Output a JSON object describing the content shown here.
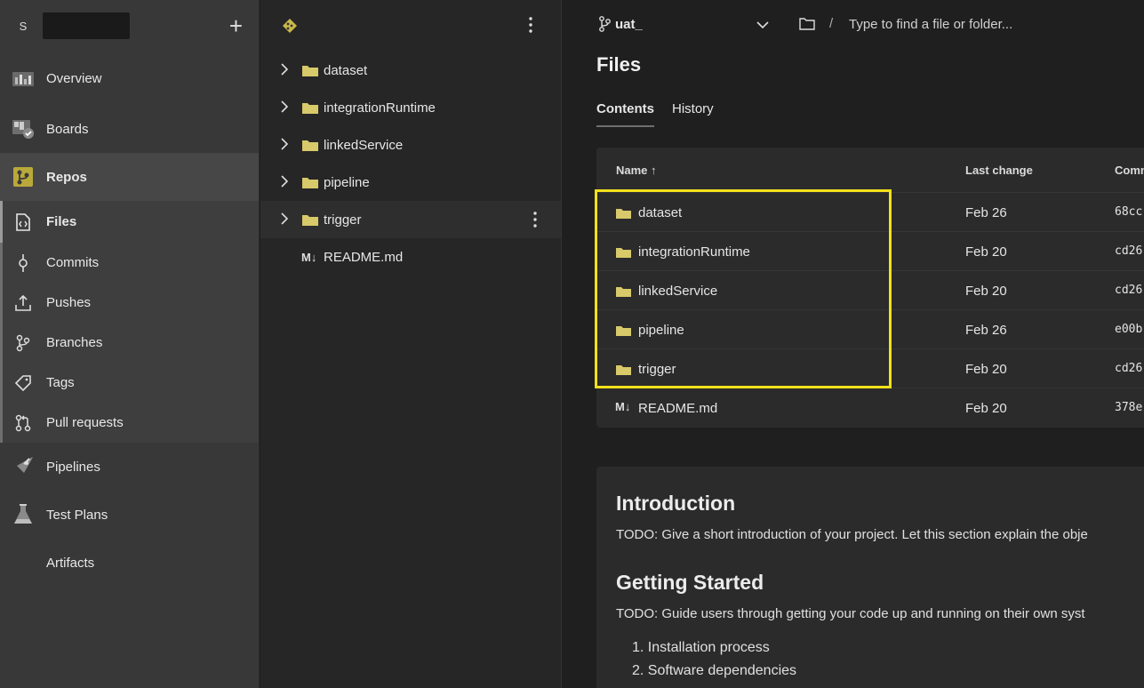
{
  "nav": {
    "org_initial": "S",
    "add_symbol": "+",
    "items": [
      {
        "label": "Overview"
      },
      {
        "label": "Boards"
      },
      {
        "label": "Repos"
      },
      {
        "label": "Files"
      },
      {
        "label": "Commits"
      },
      {
        "label": "Pushes"
      },
      {
        "label": "Branches"
      },
      {
        "label": "Tags"
      },
      {
        "label": "Pull requests"
      },
      {
        "label": "Pipelines"
      },
      {
        "label": "Test Plans"
      },
      {
        "label": "Artifacts"
      }
    ]
  },
  "tree": {
    "items": [
      {
        "label": "dataset"
      },
      {
        "label": "integrationRuntime"
      },
      {
        "label": "linkedService"
      },
      {
        "label": "pipeline"
      },
      {
        "label": "trigger"
      }
    ],
    "readme": {
      "icon_text": "M↓",
      "label": "README.md"
    }
  },
  "topbar": {
    "branch": "uat_",
    "path_separator": "/",
    "search_placeholder": "Type to find a file or folder..."
  },
  "main": {
    "title": "Files",
    "tabs": [
      {
        "label": "Contents"
      },
      {
        "label": "History"
      }
    ]
  },
  "table": {
    "headers": {
      "name": "Name ↑",
      "last_change": "Last change",
      "commits": "Comm"
    },
    "rows": [
      {
        "name": "dataset",
        "date": "Feb 26",
        "commit": "68cc"
      },
      {
        "name": "integrationRuntime",
        "date": "Feb 20",
        "commit": "cd26"
      },
      {
        "name": "linkedService",
        "date": "Feb 20",
        "commit": "cd26"
      },
      {
        "name": "pipeline",
        "date": "Feb 26",
        "commit": "e00b"
      },
      {
        "name": "trigger",
        "date": "Feb 20",
        "commit": "cd26"
      },
      {
        "name": "README.md",
        "date": "Feb 20",
        "commit": "378e",
        "icon_text": "M↓"
      }
    ]
  },
  "readme": {
    "h_intro": "Introduction",
    "p_intro": "TODO: Give a short introduction of your project. Let this section explain the obje",
    "h_start": "Getting Started",
    "p_start": "TODO: Guide users through getting your code up and running on their own syst",
    "steps": [
      "1. Installation process",
      "2. Software dependencies"
    ]
  },
  "colors": {
    "highlight": "#f2e01a",
    "folder": "#d8c96a",
    "nav_bg": "#383838"
  }
}
